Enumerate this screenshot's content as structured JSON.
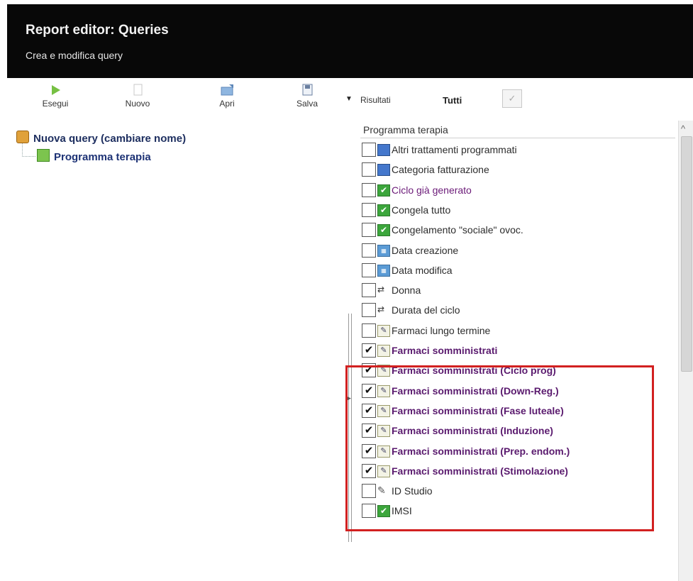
{
  "header": {
    "title": "Report editor: Queries",
    "subtitle": "Crea e modifica query"
  },
  "toolbar": {
    "buttons": [
      {
        "label": "Esegui",
        "icon": "play-icon"
      },
      {
        "label": "Nuovo",
        "icon": "new-document-icon"
      },
      {
        "label": "Apri",
        "icon": "open-folder-icon"
      },
      {
        "label": "Salva",
        "icon": "save-icon"
      }
    ],
    "results_label": "Risultati",
    "all_label": "Tutti"
  },
  "tree": {
    "root": "Nuova query (cambiare nome)",
    "child": "Programma terapia"
  },
  "panel": {
    "header": "Programma terapia",
    "fields": [
      {
        "label": "Altri trattamenti programmati",
        "icon": "calc",
        "checked": false,
        "style": ""
      },
      {
        "label": "Categoria fatturazione",
        "icon": "calc",
        "checked": false,
        "style": ""
      },
      {
        "label": "Ciclo già generato",
        "icon": "bool",
        "checked": false,
        "style": "purple"
      },
      {
        "label": "Congela tutto",
        "icon": "bool",
        "checked": false,
        "style": ""
      },
      {
        "label": "Congelamento \"sociale\" ovoc.",
        "icon": "bool",
        "checked": false,
        "style": ""
      },
      {
        "label": "Data creazione",
        "icon": "date",
        "checked": false,
        "style": ""
      },
      {
        "label": "Data modifica",
        "icon": "date",
        "checked": false,
        "style": ""
      },
      {
        "label": "Donna",
        "icon": "link",
        "checked": false,
        "style": ""
      },
      {
        "label": "Durata del ciclo",
        "icon": "link",
        "checked": false,
        "style": ""
      },
      {
        "label": "Farmaci lungo termine",
        "icon": "edit",
        "checked": false,
        "style": ""
      },
      {
        "label": "Farmaci somministrati",
        "icon": "edit",
        "checked": true,
        "style": "bold"
      },
      {
        "label": "Farmaci somministrati (Ciclo prog)",
        "icon": "edit",
        "checked": true,
        "style": "bold"
      },
      {
        "label": "Farmaci somministrati (Down-Reg.)",
        "icon": "edit",
        "checked": true,
        "style": "bold"
      },
      {
        "label": "Farmaci somministrati (Fase luteale)",
        "icon": "edit",
        "checked": true,
        "style": "bold"
      },
      {
        "label": "Farmaci somministrati (Induzione)",
        "icon": "edit",
        "checked": true,
        "style": "bold"
      },
      {
        "label": "Farmaci somministrati (Prep. endom.)",
        "icon": "edit",
        "checked": true,
        "style": "bold"
      },
      {
        "label": "Farmaci somministrati (Stimolazione)",
        "icon": "edit",
        "checked": true,
        "style": "bold"
      },
      {
        "label": "ID Studio",
        "icon": "tool",
        "checked": false,
        "style": ""
      },
      {
        "label": "IMSI",
        "icon": "bool",
        "checked": false,
        "style": ""
      }
    ]
  },
  "icon_glyphs": {
    "bool": "✔",
    "date": "▦",
    "link": "⇄",
    "edit": "✎",
    "tool": "✎"
  },
  "colors": {
    "header_bg": "#080808",
    "highlight_border": "#d22020",
    "selected_text": "#5a1a6e"
  }
}
